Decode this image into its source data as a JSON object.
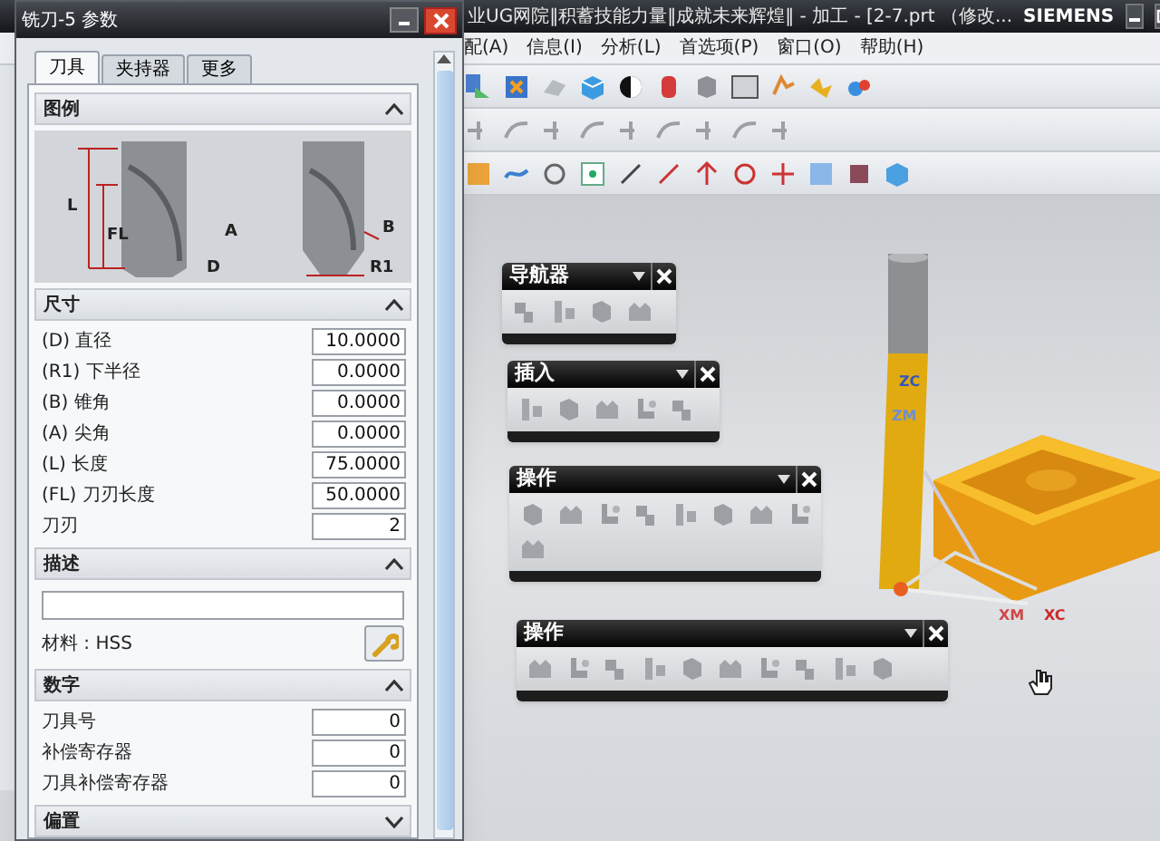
{
  "dialog": {
    "title": "铣刀-5 参数",
    "tabs": [
      {
        "label": "刀具",
        "selected": true
      },
      {
        "label": "夹持器",
        "selected": false
      },
      {
        "label": "更多",
        "selected": false
      }
    ],
    "sections": [
      {
        "kind": "legend",
        "title": "图例",
        "expanded": true,
        "labels": [
          "L",
          "FL",
          "A",
          "D",
          "R1",
          "B"
        ]
      },
      {
        "kind": "fields",
        "title": "尺寸",
        "expanded": true,
        "fields": [
          {
            "label": "(D) 直径",
            "value": "10.0000"
          },
          {
            "label": "(R1) 下半径",
            "value": "0.0000"
          },
          {
            "label": "(B) 锥角",
            "value": "0.0000"
          },
          {
            "label": "(A) 尖角",
            "value": "0.0000"
          },
          {
            "label": "(L) 长度",
            "value": "75.0000"
          },
          {
            "label": "(FL) 刀刃长度",
            "value": "50.0000"
          },
          {
            "label": "刀刃",
            "value": "2"
          }
        ]
      },
      {
        "kind": "description",
        "title": "描述",
        "expanded": true,
        "material": "材料 : HSS"
      },
      {
        "kind": "fields",
        "title": "数字",
        "expanded": true,
        "fields": [
          {
            "label": "刀具号",
            "value": "0"
          },
          {
            "label": "补偿寄存器",
            "value": "0"
          },
          {
            "label": "刀具补偿寄存器",
            "value": "0"
          }
        ]
      },
      {
        "title": "偏置",
        "expanded": false
      }
    ]
  },
  "main_window": {
    "title": "业UG网院‖积蓄技能力量‖成就未来辉煌‖ - 加工 - [2-7.prt （修改...",
    "brand": "SIEMENS",
    "menu": [
      "配(A)",
      "信息(I)",
      "分析(L)",
      "首选项(P)",
      "窗口(O)",
      "帮助(H)"
    ]
  },
  "palettes": [
    {
      "title": "导航器"
    },
    {
      "title": "插入"
    },
    {
      "title": "操作"
    },
    {
      "title": "操作"
    }
  ],
  "viewport": {
    "axis_labels": [
      {
        "text": "ZC",
        "color": "#3456b8"
      },
      {
        "text": "ZM",
        "color": "#6f8fd0"
      },
      {
        "text": "XM",
        "color": "#d04848"
      },
      {
        "text": "XC",
        "color": "#cc2a2a"
      }
    ]
  }
}
